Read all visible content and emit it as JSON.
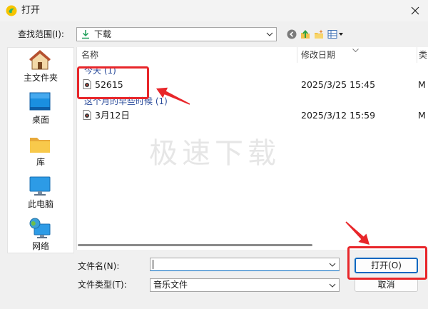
{
  "window": {
    "title": "打开",
    "close_icon": "close-icon"
  },
  "lookin": {
    "label": "查找范围(I):",
    "value": "下载",
    "icon": "download-icon"
  },
  "toolbar": {
    "icons": [
      "back-icon",
      "up-folder-icon",
      "new-folder-icon",
      "view-menu-icon"
    ]
  },
  "places": [
    {
      "label": "主文件夹",
      "icon": "home-icon"
    },
    {
      "label": "桌面",
      "icon": "desktop-icon"
    },
    {
      "label": "库",
      "icon": "library-icon"
    },
    {
      "label": "此电脑",
      "icon": "this-pc-icon"
    },
    {
      "label": "网络",
      "icon": "network-icon"
    }
  ],
  "list": {
    "columns": {
      "name": "名称",
      "date": "修改日期",
      "type": "类"
    },
    "groups": [
      {
        "header": "今天 (1)",
        "items": [
          {
            "name": "52615",
            "date": "2025/3/25 15:45",
            "type": "M",
            "icon": "audio-file-icon"
          }
        ]
      },
      {
        "header": "这个月的早些时候 (1)",
        "items": [
          {
            "name": "3月12日",
            "date": "2025/3/12 15:59",
            "type": "M",
            "icon": "audio-file-icon"
          }
        ]
      }
    ],
    "watermark": "极速下载"
  },
  "filename": {
    "label": "文件名(N):",
    "value": ""
  },
  "filetype": {
    "label": "文件类型(T):",
    "value": "音乐文件"
  },
  "buttons": {
    "open": "打开(O)",
    "cancel": "取消"
  },
  "colors": {
    "bg": "#f0f0f0",
    "title-bg": "#f3f3f3",
    "panel": "#ffffff",
    "group": "#2b4c9b",
    "accent": "#0067c0",
    "annotation": "#e8262a",
    "watermark": "#e6e6e6"
  }
}
